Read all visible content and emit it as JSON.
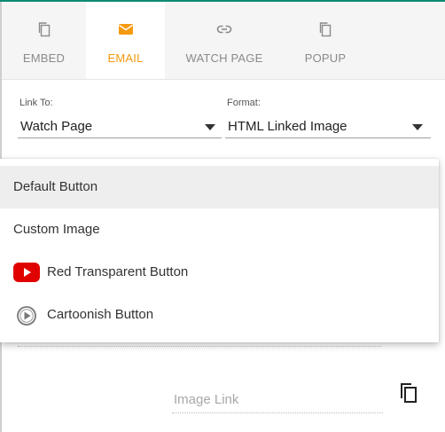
{
  "colors": {
    "accent": "#f59a0f",
    "top_line": "#0f8a74",
    "youtube_red": "#e00000"
  },
  "tabs": [
    {
      "label": "EMBED",
      "icon": "copy-icon",
      "active": false
    },
    {
      "label": "EMAIL",
      "icon": "envelope-icon",
      "active": true
    },
    {
      "label": "WATCH PAGE",
      "icon": "link-icon",
      "active": false
    },
    {
      "label": "POPUP",
      "icon": "copy-icon",
      "active": false
    }
  ],
  "link_to": {
    "label": "Link To:",
    "value": "Watch Page"
  },
  "format": {
    "label": "Format:",
    "value": "HTML Linked Image"
  },
  "dropdown": {
    "items": [
      {
        "label": "Default Button",
        "selected": true,
        "icon": ""
      },
      {
        "label": "Custom Image",
        "selected": false,
        "icon": ""
      },
      {
        "label": "Red Transparent Button",
        "selected": false,
        "icon": "youtube-play-icon"
      },
      {
        "label": "Cartoonish Button",
        "selected": false,
        "icon": "cartoon-play-icon"
      }
    ]
  },
  "image_link": {
    "placeholder": "Image Link"
  },
  "copy_button_icon": "copy-icon"
}
